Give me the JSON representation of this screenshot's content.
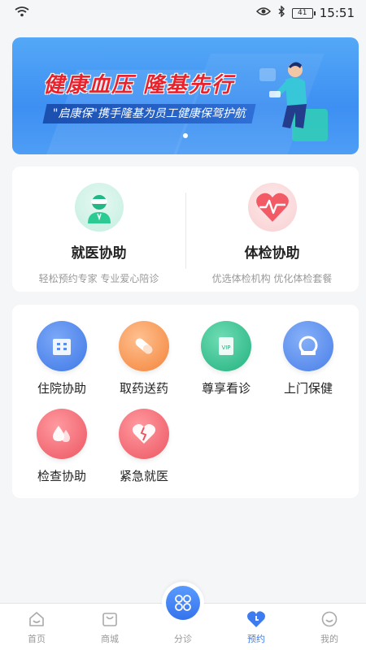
{
  "status_bar": {
    "battery": "41",
    "time": "15:51",
    "icons": [
      "wifi-icon",
      "eye-icon",
      "bluetooth-icon",
      "battery-icon"
    ]
  },
  "banner": {
    "title": "健康血压 隆基先行",
    "subtitle": "\"启康保\"携手隆基为员工健康保驾护航",
    "accent_color": "#e8232e",
    "bg_color": "#4395f4"
  },
  "main_services": [
    {
      "title": "就医协助",
      "subtitle": "轻松预约专家 专业爱心陪诊",
      "icon": "doctor-icon",
      "color": "#27c08f"
    },
    {
      "title": "体检协助",
      "subtitle": "优选体检机构 优化体检套餐",
      "icon": "heart-pulse-icon",
      "color": "#f05a68"
    }
  ],
  "services": [
    {
      "label": "住院协助",
      "icon": "hospital-icon",
      "color": "#4a86ee"
    },
    {
      "label": "取药送药",
      "icon": "pill-icon",
      "color": "#f58a3c"
    },
    {
      "label": "尊享看诊",
      "icon": "vip-icon",
      "color": "#27bb86",
      "icon_text": "VIP"
    },
    {
      "label": "上门保健",
      "icon": "home-care-icon",
      "color": "#4a86ee"
    },
    {
      "label": "检查协助",
      "icon": "blood-drop-icon",
      "color": "#ef5a63"
    },
    {
      "label": "紧急就医",
      "icon": "broken-heart-icon",
      "color": "#ef5a63"
    }
  ],
  "bottom_nav": [
    {
      "label": "首页",
      "icon": "home-icon",
      "active": false
    },
    {
      "label": "商城",
      "icon": "shop-bag-icon",
      "active": false
    },
    {
      "label": "分诊",
      "icon": "triage-icon",
      "active": false
    },
    {
      "label": "预约",
      "icon": "appointment-icon",
      "active": true
    },
    {
      "label": "我的",
      "icon": "profile-icon",
      "active": false
    }
  ],
  "accent_color": "#3d7bf0"
}
